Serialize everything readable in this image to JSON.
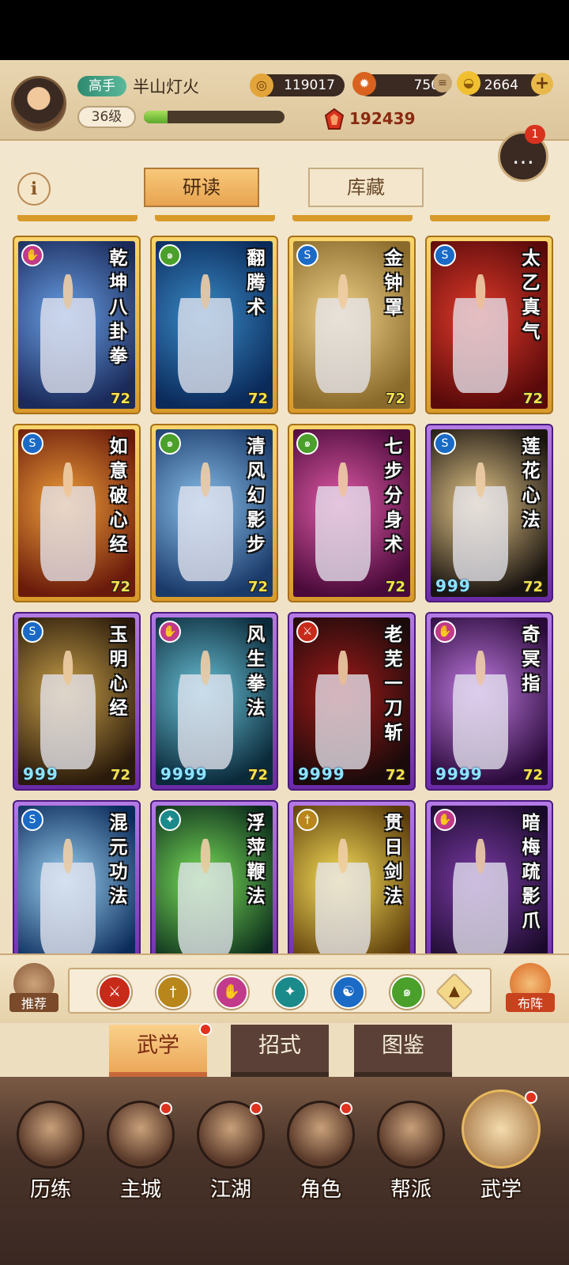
{
  "header": {
    "rank": "高手",
    "player_name": "半山灯火",
    "level": "36级",
    "xp_fraction": 0.17,
    "coins": "119017",
    "energy": "750",
    "gold": "2664",
    "power": "192439",
    "chat_badge": "1"
  },
  "tabs": {
    "study": "研读",
    "collection": "库藏"
  },
  "icons": {
    "info": "i"
  },
  "cards": [
    {
      "title": "乾坤八卦拳",
      "level": "72",
      "pips": "",
      "frame": "gold",
      "type": "palm",
      "type_color": "#c23a8a",
      "bg": [
        "#1a2a5a",
        "#6aa0e6"
      ]
    },
    {
      "title": "翻腾术",
      "level": "72",
      "pips": "",
      "frame": "gold",
      "type": "swirl",
      "type_color": "#4aa02a",
      "bg": [
        "#0a2a5a",
        "#3a8ac6"
      ]
    },
    {
      "title": "金钟罩",
      "level": "72",
      "pips": "",
      "frame": "gold",
      "type": "yinyang",
      "type_color": "#1a6ac6",
      "bg": [
        "#8a6a2a",
        "#f0d28a"
      ]
    },
    {
      "title": "太乙真气",
      "level": "72",
      "pips": "",
      "frame": "gold",
      "type": "yinyang",
      "type_color": "#1a6ac6",
      "bg": [
        "#5a0a0a",
        "#e03a2a"
      ]
    },
    {
      "title": "如意破心经",
      "level": "72",
      "pips": "",
      "frame": "gold",
      "type": "yinyang",
      "type_color": "#1a6ac6",
      "bg": [
        "#6a1a0a",
        "#f0a03a"
      ]
    },
    {
      "title": "清风幻影步",
      "level": "72",
      "pips": "",
      "frame": "gold",
      "type": "swirl",
      "type_color": "#4aa02a",
      "bg": [
        "#1a3a6a",
        "#8ac0ea"
      ]
    },
    {
      "title": "七步分身术",
      "level": "72",
      "pips": "",
      "frame": "gold",
      "type": "swirl",
      "type_color": "#4aa02a",
      "bg": [
        "#4a0a3a",
        "#e05aa6"
      ]
    },
    {
      "title": "莲花心法",
      "level": "72",
      "pips": "999",
      "frame": "purple",
      "type": "yinyang",
      "type_color": "#1a6ac6",
      "bg": [
        "#1a1410",
        "#e6c88a"
      ]
    },
    {
      "title": "玉明心经",
      "level": "72",
      "pips": "999",
      "frame": "purple",
      "type": "yinyang",
      "type_color": "#1a6ac6",
      "bg": [
        "#2a1a0a",
        "#c8a04a"
      ]
    },
    {
      "title": "风生拳法",
      "level": "72",
      "pips": "9999",
      "frame": "purple",
      "type": "palm",
      "type_color": "#c23a8a",
      "bg": [
        "#0a2a3a",
        "#6ac0d6"
      ]
    },
    {
      "title": "老芜一刀斩",
      "level": "72",
      "pips": "9999",
      "frame": "purple",
      "type": "blade",
      "type_color": "#c82a1a",
      "bg": [
        "#1a0a0a",
        "#a01a1a"
      ]
    },
    {
      "title": "奇冥指",
      "level": "72",
      "pips": "9999",
      "frame": "purple",
      "type": "palm",
      "type_color": "#c23a8a",
      "bg": [
        "#2a0a3a",
        "#c07ae0"
      ]
    },
    {
      "title": "混元功法",
      "level": "",
      "pips": "",
      "frame": "purple",
      "type": "yinyang",
      "type_color": "#1a6ac6",
      "bg": [
        "#0a2a5a",
        "#9ad0f0"
      ]
    },
    {
      "title": "浮萍鞭法",
      "level": "",
      "pips": "",
      "frame": "purple",
      "type": "fan",
      "type_color": "#1a8a8a",
      "bg": [
        "#0a2a1a",
        "#7ae05a"
      ]
    },
    {
      "title": "贯日剑法",
      "level": "",
      "pips": "",
      "frame": "purple",
      "type": "sword",
      "type_color": "#b8861a",
      "bg": [
        "#5a3a0a",
        "#f8e05a"
      ]
    },
    {
      "title": "暗梅疏影爪",
      "level": "",
      "pips": "",
      "frame": "purple",
      "type": "palm",
      "type_color": "#c23a8a",
      "bg": [
        "#1a0a2a",
        "#7a3aa6"
      ]
    }
  ],
  "filter": {
    "recommend": "推荐",
    "formation": "布阵",
    "types": [
      {
        "name": "blade",
        "color": "#c82a1a",
        "glyph": "⚔"
      },
      {
        "name": "sword",
        "color": "#b8861a",
        "glyph": "†"
      },
      {
        "name": "palm",
        "color": "#c23a8a",
        "glyph": "✋"
      },
      {
        "name": "fan",
        "color": "#1a8a8a",
        "glyph": "✦"
      },
      {
        "name": "yinyang",
        "color": "#1a6ac6",
        "glyph": "☯"
      },
      {
        "name": "swirl",
        "color": "#4aa02a",
        "glyph": "๑"
      }
    ]
  },
  "subtabs": {
    "martial": "武学",
    "moves": "招式",
    "codex": "图鉴"
  },
  "nav": [
    {
      "label": "历练",
      "dot": false
    },
    {
      "label": "主城",
      "dot": true
    },
    {
      "label": "江湖",
      "dot": true
    },
    {
      "label": "角色",
      "dot": true
    },
    {
      "label": "帮派",
      "dot": false
    },
    {
      "label": "武学",
      "dot": true
    }
  ]
}
